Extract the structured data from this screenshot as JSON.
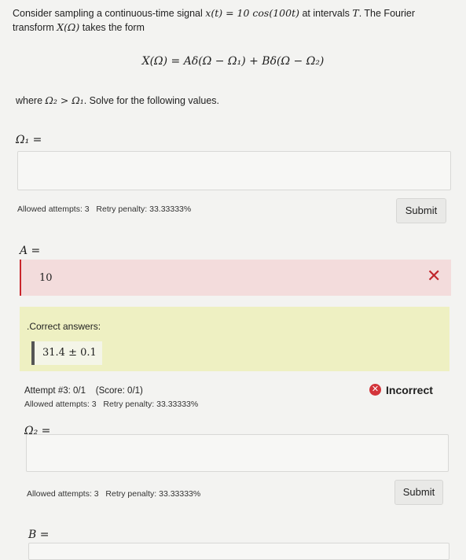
{
  "prompt": {
    "line1_pre": "Consider sampling a continuous-time signal ",
    "signal": "x(t) = 10 cos(100t)",
    "line1_mid": " at intervals ",
    "T": "T",
    "line1_end": ". The Fourier",
    "line2_pre": "transform ",
    "X": "X(Ω)",
    "line2_end": " takes the form",
    "equation": "X(Ω) = Aδ(Ω − Ω₁) + Bδ(Ω − Ω₂)",
    "where_pre": "where ",
    "where_cond": "Ω₂ > Ω₁",
    "where_end": ". Solve for the following values."
  },
  "q1": {
    "label": "Ω₁ =",
    "value": "",
    "attempts": "Allowed attempts: 3",
    "penalty": "Retry penalty: 33.33333%",
    "submit": "Submit"
  },
  "q2": {
    "label": "A =",
    "value": "10",
    "correct_title": ".Correct answers:",
    "correct_answer": "31.4 ± 0.1",
    "attempt_info": "Attempt #3: 0/1",
    "score": "(Score: 0/1)",
    "attempts": "Allowed attempts: 3",
    "penalty": "Retry penalty: 33.33333%",
    "status": "Incorrect",
    "status_color": "#d3343a"
  },
  "q3": {
    "label": "Ω₂ =",
    "value": "",
    "attempts": "Allowed attempts: 3",
    "penalty": "Retry penalty: 33.33333%",
    "submit": "Submit"
  },
  "q4": {
    "label": "B ="
  }
}
